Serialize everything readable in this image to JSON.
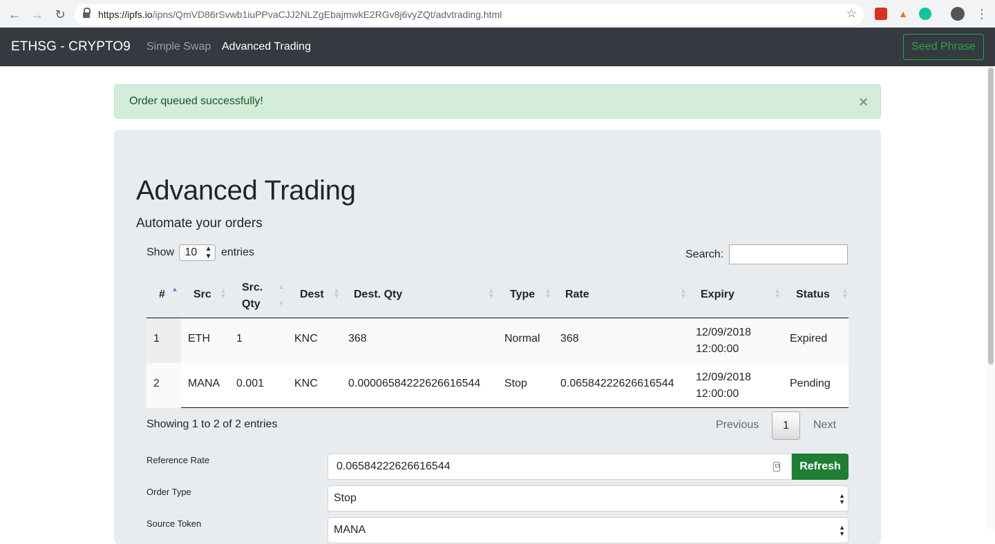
{
  "browser": {
    "url_host": "https://ipfs.io",
    "url_path": "/ipns/QmVD86rSvwb1iuPPvaCJJ2NLZgEbajmwkE2RGv8j6vyZQt/advtrading.html"
  },
  "navbar": {
    "brand": "ETHSG - CRYPTO9",
    "links": [
      {
        "label": "Simple Swap",
        "active": false
      },
      {
        "label": "Advanced Trading",
        "active": true
      }
    ],
    "seed_button": "Seed Phrase"
  },
  "alert": {
    "text": "Order queued successfully!",
    "close": "×"
  },
  "page": {
    "title": "Advanced Trading",
    "subtitle": "Automate your orders"
  },
  "table_controls": {
    "show_label": "Show",
    "entries_value": "10",
    "entries_label": "entries",
    "search_label": "Search:"
  },
  "table": {
    "headers": [
      "#",
      "Src",
      "Src. Qty",
      "Dest",
      "Dest. Qty",
      "Type",
      "Rate",
      "Expiry",
      "Status"
    ],
    "rows": [
      {
        "num": "1",
        "src": "ETH",
        "src_qty": "1",
        "dest": "KNC",
        "dest_qty": "368",
        "type": "Normal",
        "rate": "368",
        "expiry": "12/09/2018 12:00:00",
        "status": "Expired"
      },
      {
        "num": "2",
        "src": "MANA",
        "src_qty": "0.001",
        "dest": "KNC",
        "dest_qty": "0.00006584222626616544",
        "type": "Stop",
        "rate": "0.06584222626616544",
        "expiry": "12/09/2018 12:00:00",
        "status": "Pending"
      }
    ]
  },
  "pagination": {
    "info": "Showing 1 to 2 of 2 entries",
    "previous": "Previous",
    "current": "1",
    "next": "Next"
  },
  "form": {
    "reference_rate_label": "Reference Rate",
    "reference_rate_value": "0.06584222626616544",
    "refresh_button": "Refresh",
    "order_type_label": "Order Type",
    "order_type_value": "Stop",
    "source_token_label": "Source Token",
    "source_token_value": "MANA"
  },
  "colors": {
    "navbar_bg": "#343a40",
    "seed_green": "#28a745",
    "alert_bg": "#d4edda",
    "alert_text": "#155724",
    "jumbotron_bg": "#e9ecef",
    "refresh_bg": "#1e7e34"
  }
}
